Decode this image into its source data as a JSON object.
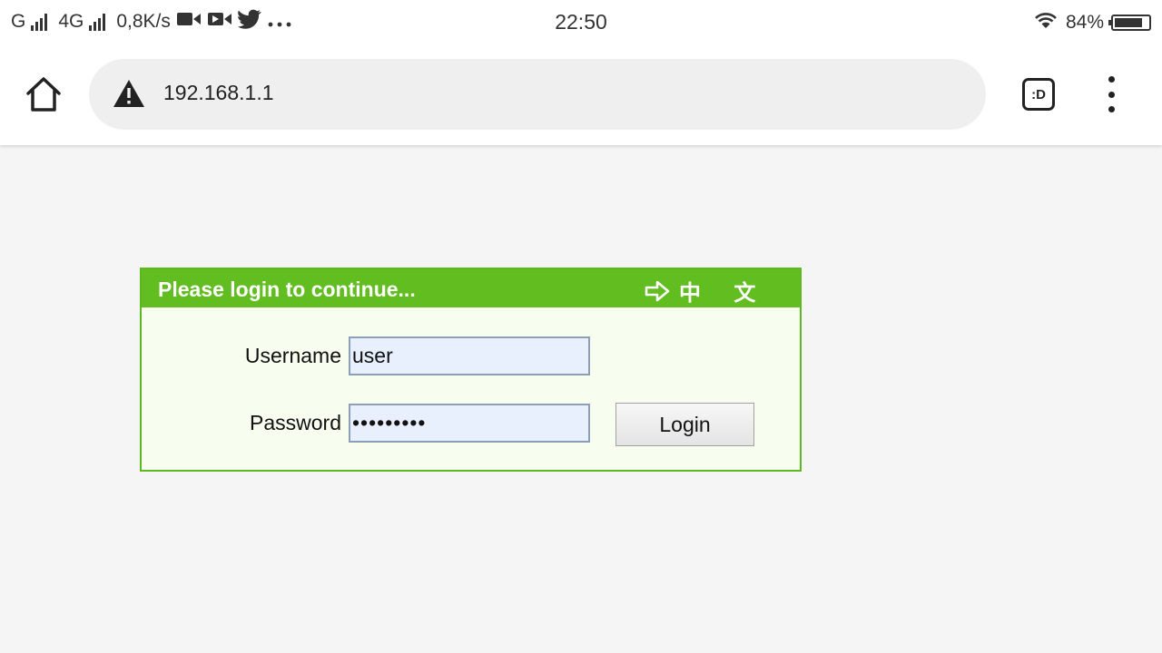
{
  "status_bar": {
    "network_1": "G",
    "network_2": "4G",
    "speed": "0,8K/s",
    "time": "22:50",
    "battery_percent": "84%",
    "battery_level": 0.84
  },
  "browser": {
    "url": "192.168.1.1",
    "tabs_label": ":D",
    "icons": [
      "home-icon",
      "warning-icon",
      "tabs-icon",
      "overflow-menu-icon"
    ]
  },
  "login": {
    "title": "Please login to continue...",
    "language_link": "中 文",
    "username_label": "Username",
    "username_value": "user",
    "password_label": "Password",
    "password_value": "•••••••••",
    "login_button": "Login"
  },
  "colors": {
    "header_green": "#62bd21",
    "panel_bg": "#f7fef0",
    "input_bg": "#e8f0fe",
    "page_bg": "#f5f5f5"
  }
}
